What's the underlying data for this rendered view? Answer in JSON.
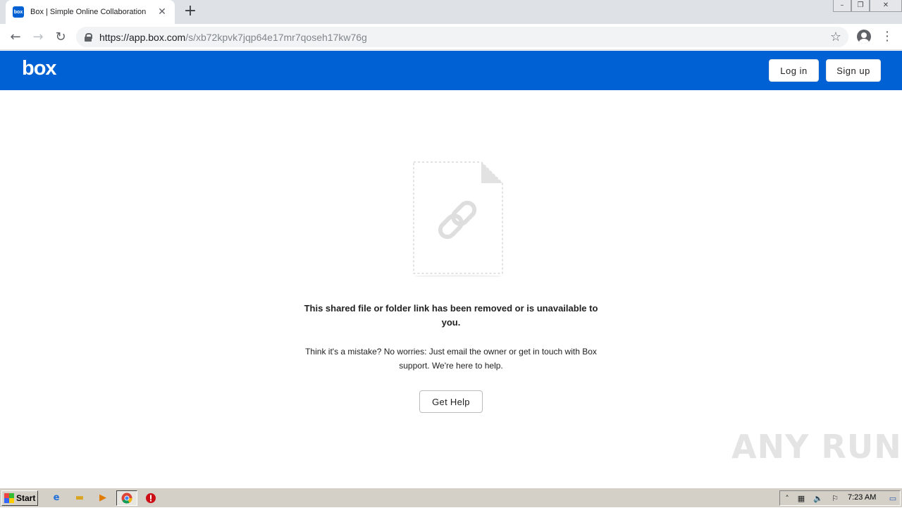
{
  "browser": {
    "tab_title": "Box | Simple Online Collaboration",
    "favicon_text": "box",
    "url_host": "https://app.box.com",
    "url_path": "/s/xb72kpvk7jqp64e17mr7qoseh17kw76g"
  },
  "header": {
    "logo": "box",
    "login_label": "Log in",
    "signup_label": "Sign up",
    "color": "#0061d5"
  },
  "content": {
    "title": "This shared file or folder link has been removed or is unavailable to you.",
    "body": "Think it's a mistake? No worries: Just email the owner or get in touch with Box support. We're here to help.",
    "help_label": "Get Help"
  },
  "watermark": "ANY RUN",
  "taskbar": {
    "start_label": "Start",
    "clock": "7:23 AM"
  }
}
